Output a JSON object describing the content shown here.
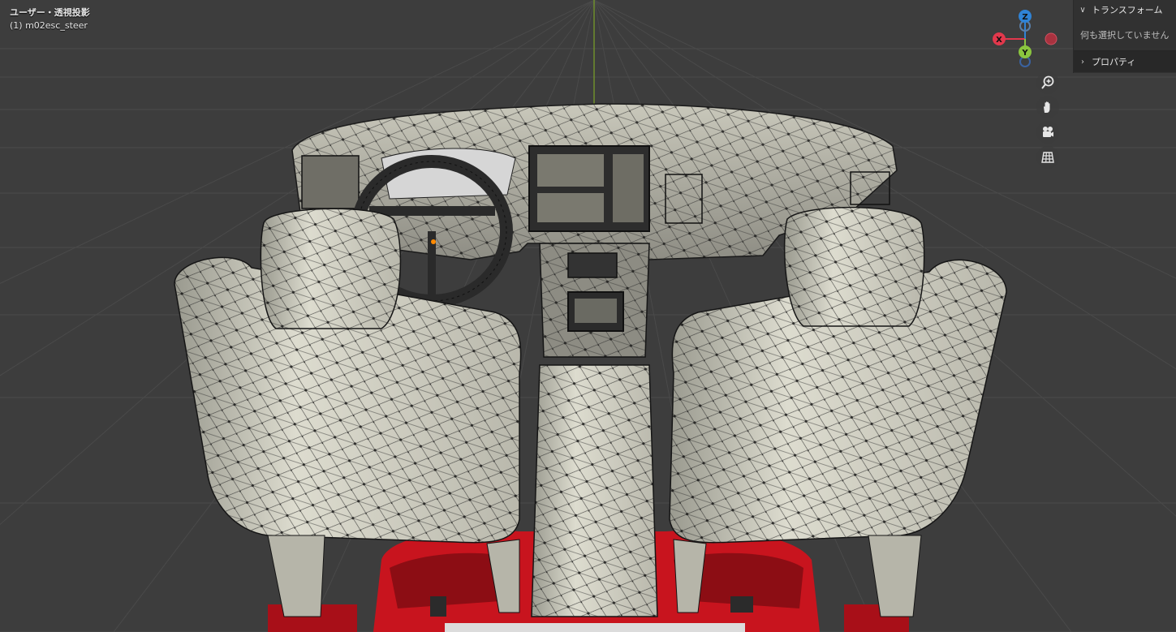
{
  "viewport": {
    "view_title": "ユーザー・透視投影",
    "object_name": "(1) m02esc_steer"
  },
  "gizmo": {
    "x_label": "X",
    "y_label": "Y",
    "z_label": "Z",
    "colors": {
      "x": "#e2384c",
      "y": "#8ac53f",
      "z": "#2f83d6"
    }
  },
  "npanel": {
    "transform_label": "トランスフォーム",
    "empty_message": "何も選択していません",
    "properties_label": "プロパティ"
  },
  "nav_buttons": [
    "zoom-icon",
    "pan-hand-icon",
    "camera-icon",
    "orthographic-grid-icon"
  ],
  "colors": {
    "background": "#3d3d3d",
    "mesh_surface": "#cfcec0",
    "car_body": "#c8141e",
    "dark_part": "#333333"
  }
}
